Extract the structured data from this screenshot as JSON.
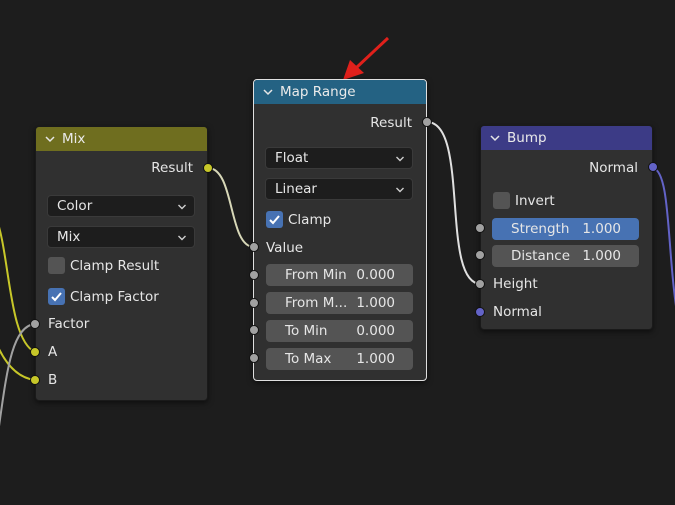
{
  "colors": {
    "background": "#1d1d1d",
    "node_body": "#303030",
    "mix_header": "#6f6e1f",
    "map_range_header": "#246283",
    "bump_header": "#3c3b86",
    "socket_float": "#a1a1a1",
    "socket_color": "#c7c729",
    "socket_vector": "#6363c7",
    "field_active": "#4772b3",
    "arrow": "#e0201b"
  },
  "nodes": {
    "mix": {
      "title": "Mix",
      "output_label": "Result",
      "data_type": "Color",
      "blend_mode": "Mix",
      "clamp_result_label": "Clamp Result",
      "clamp_result_checked": false,
      "clamp_factor_label": "Clamp Factor",
      "clamp_factor_checked": true,
      "inputs": [
        "Factor",
        "A",
        "B"
      ]
    },
    "map_range": {
      "title": "Map Range",
      "output_label": "Result",
      "data_type": "Float",
      "interpolation": "Linear",
      "clamp_label": "Clamp",
      "clamp_checked": true,
      "value_label": "Value",
      "fields": [
        {
          "label": "From Min",
          "value": "0.000"
        },
        {
          "label": "From M...",
          "value": "1.000"
        },
        {
          "label": "To Min",
          "value": "0.000"
        },
        {
          "label": "To Max",
          "value": "1.000"
        }
      ]
    },
    "bump": {
      "title": "Bump",
      "output_label": "Normal",
      "invert_label": "Invert",
      "invert_checked": false,
      "fields": [
        {
          "label": "Strength",
          "value": "1.000",
          "active": true
        },
        {
          "label": "Distance",
          "value": "1.000",
          "active": false
        }
      ],
      "inputs": [
        "Height",
        "Normal"
      ]
    }
  },
  "icons": {
    "collapse": "chevron-down-icon",
    "dropdown": "chevron-down-icon",
    "check": "checkmark-icon",
    "annotation": "red-arrow-icon"
  }
}
